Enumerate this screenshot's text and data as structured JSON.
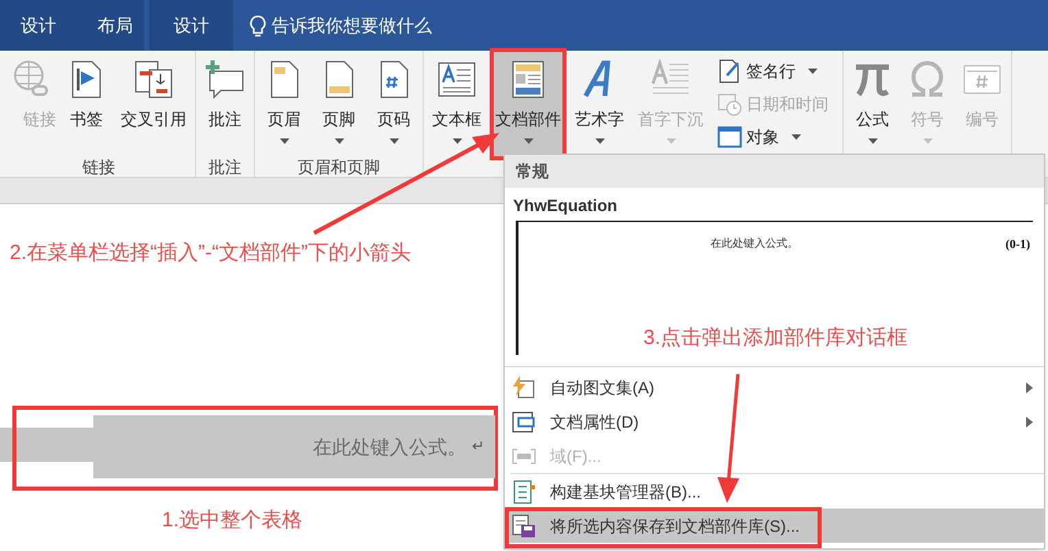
{
  "tabs": [
    {
      "label": "设计"
    },
    {
      "label": "布局"
    },
    {
      "label": "设计"
    }
  ],
  "tell_me": {
    "placeholder": "告诉我你想要做什么"
  },
  "ribbon_groups": [
    {
      "label": "链接",
      "buttons": [
        {
          "label": "链接",
          "kind": "globe",
          "disabled": true,
          "dropdown": false,
          "selected": false
        },
        {
          "label": "书签",
          "kind": "bookmark",
          "disabled": false,
          "dropdown": false,
          "selected": false
        },
        {
          "label": "交叉引用",
          "kind": "crossref",
          "disabled": false,
          "dropdown": false,
          "selected": false
        }
      ]
    },
    {
      "label": "批注",
      "buttons": [
        {
          "label": "批注",
          "kind": "comment",
          "disabled": false,
          "dropdown": false,
          "selected": false
        }
      ]
    },
    {
      "label": "页眉和页脚",
      "buttons": [
        {
          "label": "页眉",
          "kind": "header",
          "disabled": false,
          "dropdown": true,
          "selected": false
        },
        {
          "label": "页脚",
          "kind": "footer",
          "disabled": false,
          "dropdown": true,
          "selected": false
        },
        {
          "label": "页码",
          "kind": "pagenum",
          "disabled": false,
          "dropdown": true,
          "selected": false
        }
      ]
    },
    {
      "buttons": [
        {
          "label": "文本框",
          "kind": "textbox",
          "disabled": false,
          "dropdown": true,
          "selected": false
        },
        {
          "label": "文档部件",
          "kind": "parts",
          "disabled": false,
          "dropdown": true,
          "selected": true
        },
        {
          "label": "艺术字",
          "kind": "wordart",
          "disabled": false,
          "dropdown": true,
          "selected": false
        },
        {
          "label": "首字下沉",
          "kind": "dropcap",
          "disabled": true,
          "dropdown": true,
          "selected": false
        }
      ],
      "small_buttons": [
        {
          "label": "签名行",
          "kind": "signature",
          "disabled": false,
          "dropdown": true
        },
        {
          "label": "日期和时间",
          "kind": "datetime",
          "disabled": true,
          "dropdown": false
        },
        {
          "label": "对象",
          "kind": "object",
          "disabled": false,
          "dropdown": true
        }
      ]
    },
    {
      "buttons": [
        {
          "label": "公式",
          "kind": "pi",
          "disabled": false,
          "dropdown": true,
          "selected": false
        },
        {
          "label": "符号",
          "kind": "omega",
          "disabled": true,
          "dropdown": true,
          "selected": false
        },
        {
          "label": "编号",
          "kind": "number",
          "disabled": true,
          "dropdown": false,
          "selected": false
        }
      ]
    }
  ],
  "document": {
    "equation": "在此处键入公式。",
    "paragraph_mark": "↵"
  },
  "menu": {
    "section": "常规",
    "gallery_title": "YhwEquation",
    "preview_text": "在此处键入公式。",
    "preview_number": "(0-1)",
    "items": [
      {
        "label": "自动图文集(A)",
        "kind": "autotext",
        "disabled": false,
        "submenu": true,
        "selected": false
      },
      {
        "label": "文档属性(D)",
        "kind": "property",
        "disabled": false,
        "submenu": true,
        "selected": false
      },
      {
        "label": "域(F)...",
        "kind": "field",
        "disabled": true,
        "submenu": false,
        "selected": false
      },
      {
        "label": "构建基块管理器(B)...",
        "kind": "organizer",
        "disabled": false,
        "submenu": false,
        "selected": false
      },
      {
        "label": "将所选内容保存到文档部件库(S)...",
        "kind": "save",
        "disabled": false,
        "submenu": false,
        "selected": true
      }
    ]
  },
  "annotations": [
    "2.在菜单栏选择“插入”-“文档部件”下的小箭头",
    "3.点击弹出添加部件库对话框",
    "1.选中整个表格"
  ]
}
